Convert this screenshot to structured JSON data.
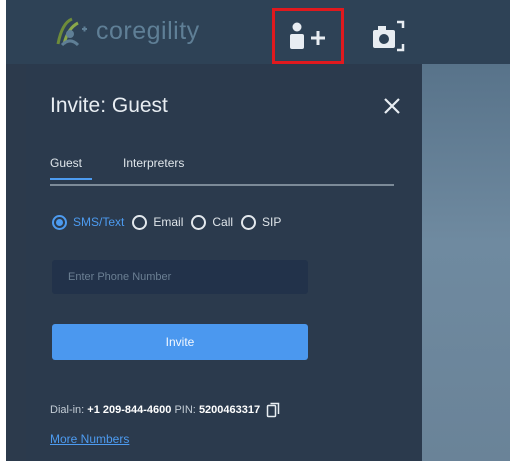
{
  "app": {
    "brand_name": "coregility"
  },
  "toolbar": {
    "invite_icon": "add-person-icon",
    "snapshot_icon": "camera-snapshot-icon",
    "highlight_color": "#e0191e"
  },
  "dialog": {
    "title": "Invite: Guest",
    "close_icon": "close-icon",
    "tabs": [
      {
        "label": "Guest",
        "active": true
      },
      {
        "label": "Interpreters",
        "active": false
      }
    ],
    "contact_methods": [
      {
        "label": "SMS/Text",
        "selected": true
      },
      {
        "label": "Email",
        "selected": false
      },
      {
        "label": "Call",
        "selected": false
      },
      {
        "label": "SIP",
        "selected": false
      }
    ],
    "phone_input": {
      "placeholder": "Enter Phone Number",
      "value": ""
    },
    "invite_button_label": "Invite",
    "dialin": {
      "label": "Dial-in:",
      "number": "+1 209-844-4600",
      "pin_label": "PIN:",
      "pin": "5200463317"
    },
    "more_numbers_label": "More Numbers"
  },
  "colors": {
    "accent": "#4d9bf0",
    "panel": "#2b3a4d",
    "topbar": "#2e4256"
  }
}
